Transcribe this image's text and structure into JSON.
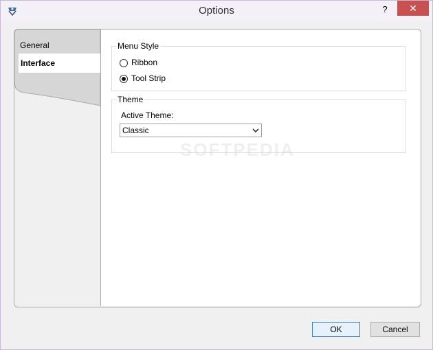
{
  "window": {
    "title": "Options",
    "help_label": "?",
    "close_label": "✕"
  },
  "nav": {
    "items": [
      {
        "label": "General"
      },
      {
        "label": "Interface"
      }
    ]
  },
  "menu_style": {
    "legend": "Menu Style",
    "options": [
      {
        "label": "Ribbon",
        "checked": false
      },
      {
        "label": "Tool Strip",
        "checked": true
      }
    ]
  },
  "theme": {
    "legend": "Theme",
    "active_label": "Active Theme:",
    "selected": "Classic"
  },
  "buttons": {
    "ok": "OK",
    "cancel": "Cancel"
  },
  "watermark": "SOFTPEDIA",
  "icons": {
    "app": "app-logo-icon",
    "dropdown": "chevron-down-icon"
  },
  "colors": {
    "close_button": "#c75050",
    "title_bg": "#f3f0f8",
    "dialog_bg": "#f0f0f0"
  }
}
